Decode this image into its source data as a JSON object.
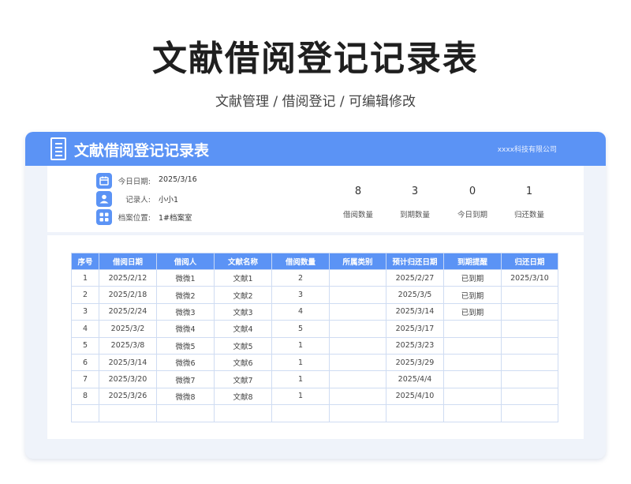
{
  "page": {
    "title": "文献借阅登记记录表",
    "subtitle": "文献管理 / 借阅登记 /  可编辑修改"
  },
  "card": {
    "title": "文献借阅登记记录表",
    "company": "xxxx科技有限公司"
  },
  "info": [
    {
      "label": "今日日期:",
      "value": "2025/3/16",
      "icon": "calendar-icon"
    },
    {
      "label": "记录人:",
      "value": "小小1",
      "icon": "person-icon"
    },
    {
      "label": "档案位置:",
      "value": "1#档案室",
      "icon": "grid-icon"
    }
  ],
  "stats": [
    {
      "value": "8",
      "label": "借阅数量"
    },
    {
      "value": "3",
      "label": "到期数量"
    },
    {
      "value": "0",
      "label": "今日到期"
    },
    {
      "value": "1",
      "label": "归还数量"
    }
  ],
  "table": {
    "headers": [
      "序号",
      "借阅日期",
      "借阅人",
      "文献名称",
      "借阅数量",
      "所属类别",
      "预计归还日期",
      "到期提醒",
      "归还日期"
    ],
    "rows": [
      [
        "1",
        "2025/2/12",
        "微微1",
        "文献1",
        "2",
        "",
        "2025/2/27",
        "已到期",
        "2025/3/10"
      ],
      [
        "2",
        "2025/2/18",
        "微微2",
        "文献2",
        "3",
        "",
        "2025/3/5",
        "已到期",
        ""
      ],
      [
        "3",
        "2025/2/24",
        "微微3",
        "文献3",
        "4",
        "",
        "2025/3/14",
        "已到期",
        ""
      ],
      [
        "4",
        "2025/3/2",
        "微微4",
        "文献4",
        "5",
        "",
        "2025/3/17",
        "",
        ""
      ],
      [
        "5",
        "2025/3/8",
        "微微5",
        "文献5",
        "1",
        "",
        "2025/3/23",
        "",
        ""
      ],
      [
        "6",
        "2025/3/14",
        "微微6",
        "文献6",
        "1",
        "",
        "2025/3/29",
        "",
        ""
      ],
      [
        "7",
        "2025/3/20",
        "微微7",
        "文献7",
        "1",
        "",
        "2025/4/4",
        "",
        ""
      ],
      [
        "8",
        "2025/3/26",
        "微微8",
        "文献8",
        "1",
        "",
        "2025/4/10",
        "",
        ""
      ],
      [
        "",
        "",
        "",
        "",
        "",
        "",
        "",
        "",
        ""
      ]
    ]
  },
  "colors": {
    "accent": "#5b93f5",
    "background": "#eff3fa"
  }
}
